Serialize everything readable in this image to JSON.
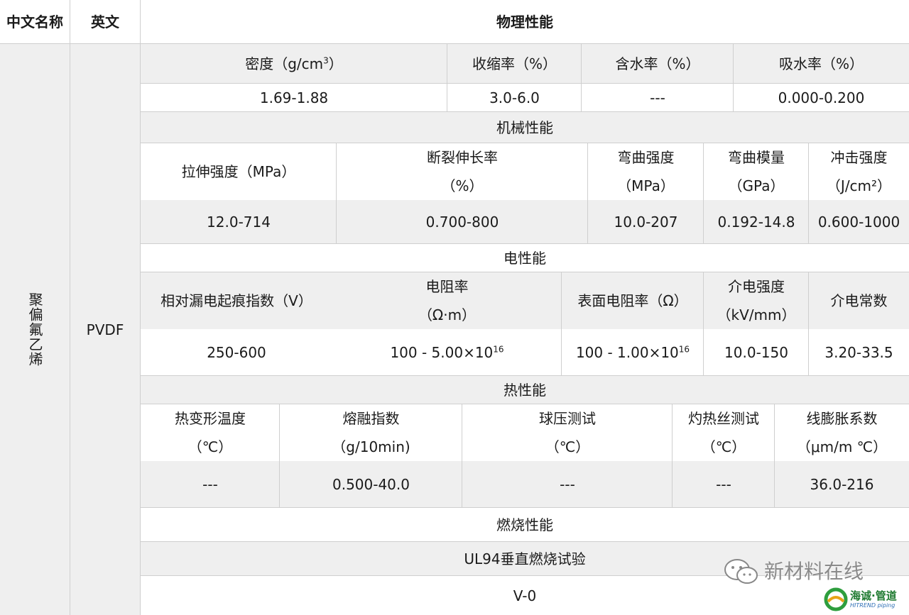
{
  "header": {
    "col_cn": "中文名称",
    "col_en": "英文",
    "col_props": "物理性能"
  },
  "material": {
    "cn": "聚偏氟乙烯",
    "en": "PVDF"
  },
  "density": {
    "h1": "密度（g/cm",
    "h1_sup": "3",
    "h1_end": "）",
    "h2": "收缩率（%）",
    "h3": "含水率（%）",
    "h4": "吸水率（%）",
    "v1": "1.69-1.88",
    "v2": "3.0-6.0",
    "v3": "---",
    "v4": "0.000-0.200"
  },
  "mechanical": {
    "title": "机械性能",
    "h1": "拉伸强度（MPa）",
    "h2a": "断裂伸长率",
    "h2b": "（%）",
    "h3a": "弯曲强度",
    "h3b": "（MPa）",
    "h4a": "弯曲模量",
    "h4b": "（GPa）",
    "h5a": "冲击强度",
    "h5b": "（J/cm²）",
    "v1": "12.0-714",
    "v2": "0.700-800",
    "v3": "10.0-207",
    "v4": "0.192-14.8",
    "v5": "0.600-1000"
  },
  "electrical": {
    "title": "电性能",
    "h1": "相对漏电起痕指数（V）",
    "h2a": "电阻率",
    "h2b": "（Ω·m）",
    "h3": "表面电阻率（Ω）",
    "h4a": "介电强度",
    "h4b": "（kV/mm）",
    "h5": "介电常数",
    "v1": "250-600",
    "v2": "100 - 5.00×10",
    "v2_sup": "16",
    "v3": "100 - 1.00×10",
    "v3_sup": "16",
    "v4": "10.0-150",
    "v5": "3.20-33.5"
  },
  "thermal": {
    "title": "热性能",
    "h1a": "热变形温度",
    "h1b": "（℃）",
    "h2a": "熔融指数",
    "h2b": "（g/10min)",
    "h3a": "球压测试",
    "h3b": "（℃）",
    "h4a": "灼热丝测试",
    "h4b": "（℃）",
    "h5a": "线膨胀系数",
    "h5b": "（μm/m ℃）",
    "v1": "---",
    "v2": "0.500-40.0",
    "v3": "---",
    "v4": "---",
    "v5": "36.0-216"
  },
  "combustion": {
    "title": "燃烧性能",
    "test": "UL94垂直燃烧试验",
    "result": "V-0"
  },
  "watermark": {
    "text": "新材料在线",
    "logo_text": "海诚·管道",
    "logo_sub": "HITREND piping",
    "icon": "wechat-icon"
  }
}
